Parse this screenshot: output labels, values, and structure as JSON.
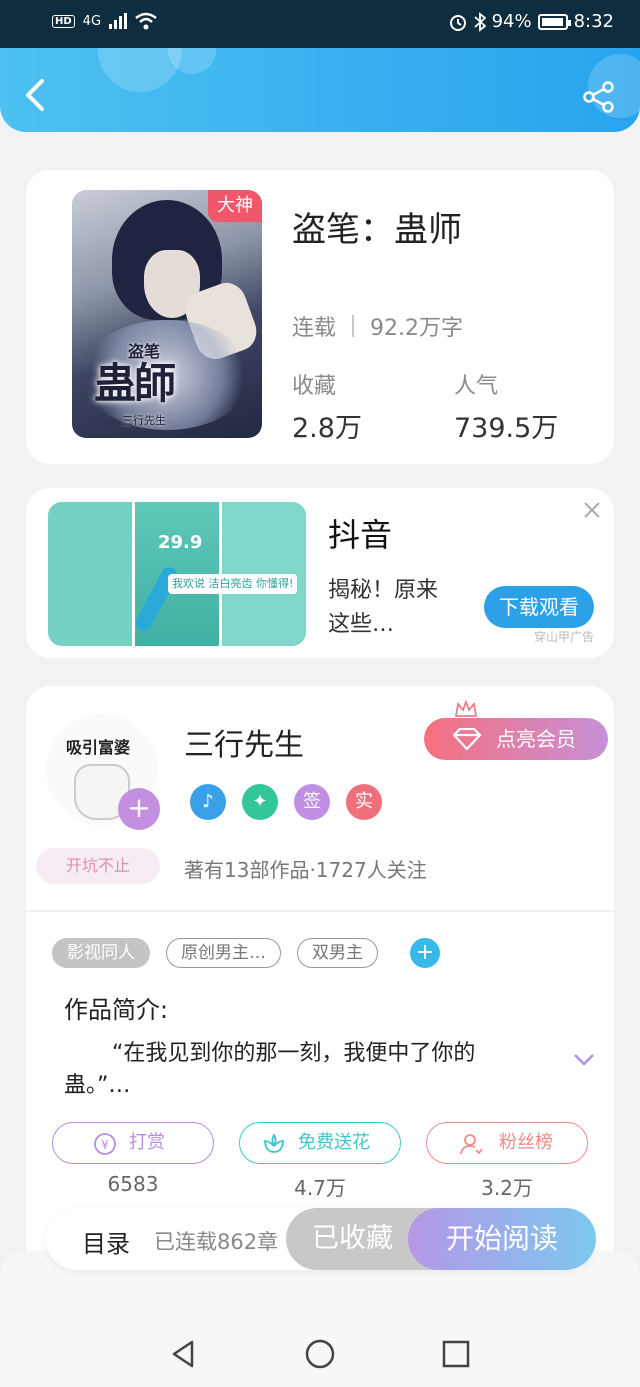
{
  "status_bar": {
    "hd": "HD",
    "network": "4G",
    "battery_pct": "94%",
    "time": "8:32"
  },
  "book": {
    "cover_badge": "大神",
    "cover_title_small": "盗笔",
    "cover_title_big": "蛊師",
    "cover_author": "三行先生",
    "title": "盗笔：蛊师",
    "status": "连载",
    "word_count": "92.2万字",
    "favorites_label": "收藏",
    "favorites_value": "2.8万",
    "popularity_label": "人气",
    "popularity_value": "739.5万"
  },
  "ad": {
    "image_price": "29.9",
    "image_bubble": "我欢说 洁白亮齿 你懂得!",
    "title": "抖音",
    "description": "揭秘！原来这些…",
    "download_label": "下载观看",
    "source": "穿山甲广告"
  },
  "author": {
    "avatar_text": "吸引富婆",
    "pendant": "开坑不止",
    "name": "三行先生",
    "vip_label": "点亮会员",
    "badges": [
      "签",
      "实"
    ],
    "meta": "著有13部作品·1727人关注"
  },
  "tags": [
    "影视同人",
    "原创男主…",
    "双男主"
  ],
  "intro": {
    "label": "作品简介:",
    "text": "“在我见到你的那一刻，我便中了你的蛊。”…"
  },
  "actions": [
    {
      "label": "打赏",
      "count": "6583",
      "color": "#b98ee0"
    },
    {
      "label": "免费送花",
      "count": "4.7万",
      "color": "#3cc7cf"
    },
    {
      "label": "粉丝榜",
      "count": "3.2万",
      "color": "#ef8b8b"
    }
  ],
  "bottom_bar": {
    "toc_label": "目录",
    "toc_count": "已连载862章",
    "collected_label": "已收藏",
    "read_label": "开始阅读"
  }
}
